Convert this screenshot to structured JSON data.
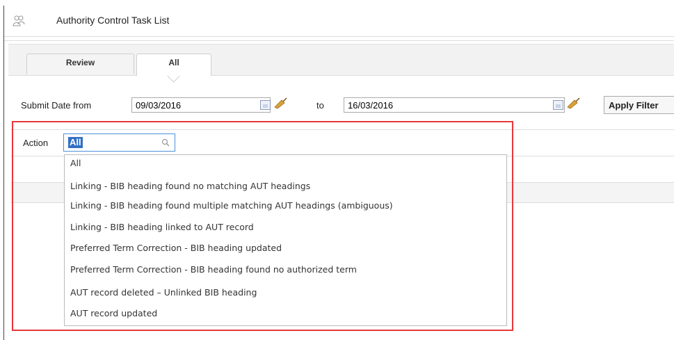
{
  "header": {
    "title": "Authority Control Task List",
    "icon": "users-icon"
  },
  "tabs": [
    {
      "label": "Review",
      "active": false
    },
    {
      "label": "All",
      "active": true
    }
  ],
  "filter": {
    "from_label": "Submit Date from",
    "from_value": "09/03/2016",
    "to_label": "to",
    "to_value": "16/03/2016",
    "apply_label": "Apply Filter"
  },
  "action": {
    "label": "Action",
    "value": "All",
    "options": [
      "All",
      "Linking - BIB heading found no matching AUT headings",
      "Linking - BIB heading found multiple matching AUT headings (ambiguous)",
      "Linking - BIB heading linked to AUT record",
      "Preferred Term Correction - BIB heading updated",
      "Preferred Term Correction - BIB heading found no authorized term",
      "AUT record deleted – Unlinked BIB heading",
      "AUT record updated"
    ]
  },
  "colors": {
    "highlight": "#e8363a",
    "accent": "#1f3e8c",
    "selection": "#3370c4"
  }
}
